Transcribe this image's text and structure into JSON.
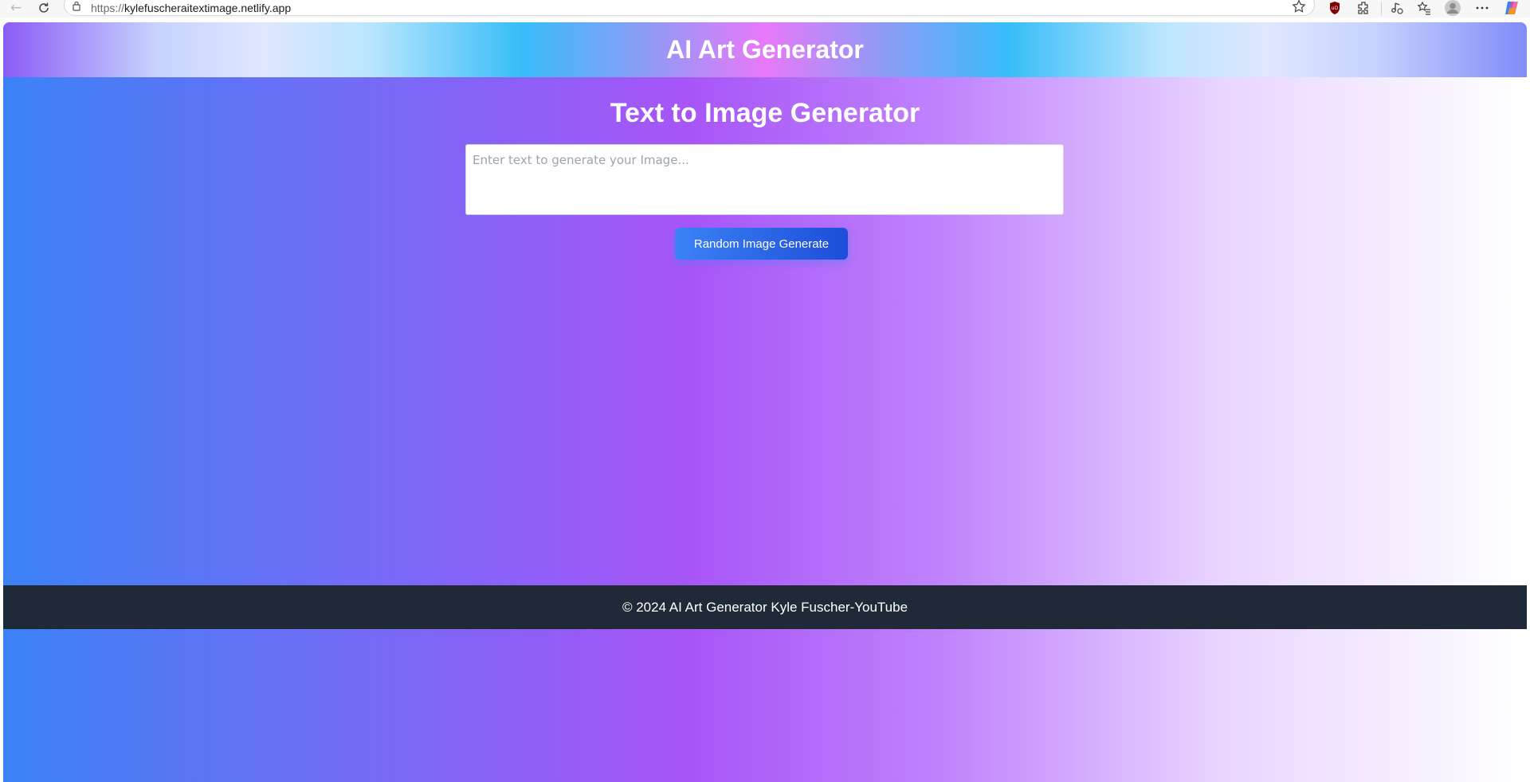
{
  "browser": {
    "url_scheme": "https://",
    "url_host": "kylefuscheraitextimage.netlify.app",
    "icons": [
      "back-icon",
      "reload-icon",
      "lock-icon",
      "star-icon",
      "ublock-extension-icon",
      "extensions-icon",
      "media-control-icon",
      "favorites-icon",
      "profile-avatar",
      "more-menu-icon",
      "copilot-icon"
    ]
  },
  "header": {
    "title": "AI Art Generator"
  },
  "main": {
    "heading": "Text to Image Generator",
    "prompt_placeholder": "Enter text to generate your Image...",
    "prompt_value": "",
    "button_label": "Random Image Generate"
  },
  "footer": {
    "text": "© 2024 AI Art Generator Kyle Fuscher-YouTube"
  },
  "colors": {
    "page_gradient_start": "#3b82f6",
    "page_gradient_mid": "#a855f7",
    "page_gradient_end": "#ffffff",
    "footer_bg": "#1f2937",
    "button_start": "#3b82f6",
    "button_end": "#1d4ed8"
  }
}
